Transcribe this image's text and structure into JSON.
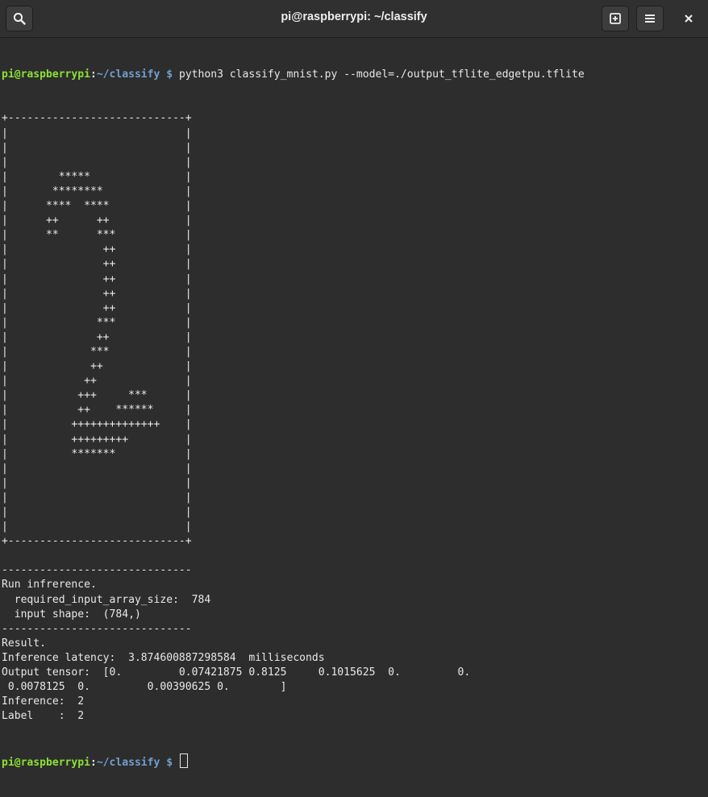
{
  "window": {
    "title": "pi@raspberrypi: ~/classify",
    "icons": [
      "search-icon",
      "new-tab-icon",
      "hamburger-menu-icon",
      "close-icon"
    ]
  },
  "prompt": {
    "user_host": "pi@raspberrypi",
    "colon": ":",
    "path": "~/classify",
    "dollar": " $ "
  },
  "command": "python3 classify_mnist.py --model=./output_tflite_edgetpu.tflite",
  "output_lines": [
    "+----------------------------+",
    "|                            |",
    "|                            |",
    "|                            |",
    "|        *****               |",
    "|       ********             |",
    "|      ****  ****            |",
    "|      ++      ++            |",
    "|      **      ***           |",
    "|               ++           |",
    "|               ++           |",
    "|               ++           |",
    "|               ++           |",
    "|               ++           |",
    "|              ***           |",
    "|              ++            |",
    "|             ***            |",
    "|             ++             |",
    "|            ++              |",
    "|           +++     ***      |",
    "|           ++    ******     |",
    "|          ++++++++++++++    |",
    "|          +++++++++         |",
    "|          *******           |",
    "|                            |",
    "|                            |",
    "|                            |",
    "|                            |",
    "|                            |",
    "+----------------------------+",
    "",
    "------------------------------",
    "Run infrerence.",
    "  required_input_array_size:  784",
    "  input shape:  (784,)",
    "------------------------------",
    "Result.",
    "Inference latency:  3.874600887298584  milliseconds",
    "Output tensor:  [0.         0.07421875 0.8125     0.1015625  0.         0.",
    " 0.0078125  0.         0.00390625 0.        ]",
    "Inference:  2",
    "Label    :  2"
  ]
}
